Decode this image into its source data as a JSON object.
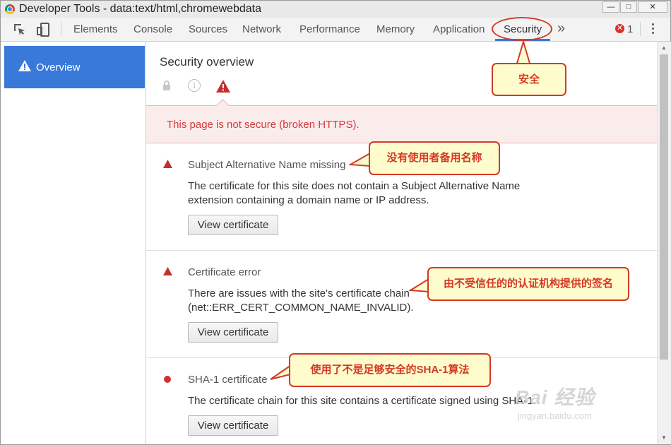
{
  "window": {
    "title": "Developer Tools - data:text/html,chromewebdata",
    "controls": [
      "—",
      "□",
      "✕"
    ]
  },
  "toolbar": {
    "tabs": [
      {
        "label": "Elements"
      },
      {
        "label": "Console"
      },
      {
        "label": "Sources"
      },
      {
        "label": "Network"
      },
      {
        "label": "Performance"
      },
      {
        "label": "Memory"
      },
      {
        "label": "Application"
      },
      {
        "label": "Security"
      }
    ],
    "more_tabs": "»",
    "error_count": "1",
    "error_badge": "✕",
    "accent_color": "#3879d9"
  },
  "sidebar": {
    "items": [
      {
        "label": "Overview",
        "icon": "warning-icon"
      }
    ]
  },
  "main": {
    "title": "Security overview",
    "summary_icons": [
      "lock-icon",
      "info-icon",
      "warning-icon"
    ],
    "banner_text": "This page is not secure (broken HTTPS).",
    "sections": [
      {
        "icon": "warning-icon",
        "heading": "Subject Alternative Name missing",
        "description": "The certificate for this site does not contain a Subject Alternative Name extension containing a domain name or IP address.",
        "button_label": "View certificate"
      },
      {
        "icon": "warning-icon",
        "heading": "Certificate error",
        "description": "There are issues with the site's certificate chain (net::ERR_CERT_COMMON_NAME_INVALID).",
        "button_label": "View certificate"
      },
      {
        "icon": "red-dot-icon",
        "heading": "SHA-1 certificate",
        "description": "The certificate chain for this site contains a certificate signed using SHA-1.",
        "button_label": "View certificate"
      }
    ]
  },
  "annotations": {
    "security_tab": "安全",
    "san_missing": "没有使用者备用名称",
    "cert_error": "由不受信任的的认证机构提供的签名",
    "sha1": "使用了不是足够安全的SHA-1算法",
    "color": "#d33a24"
  },
  "watermark": {
    "brand": "Bai 经验",
    "url": "jingyan.baidu.com"
  }
}
